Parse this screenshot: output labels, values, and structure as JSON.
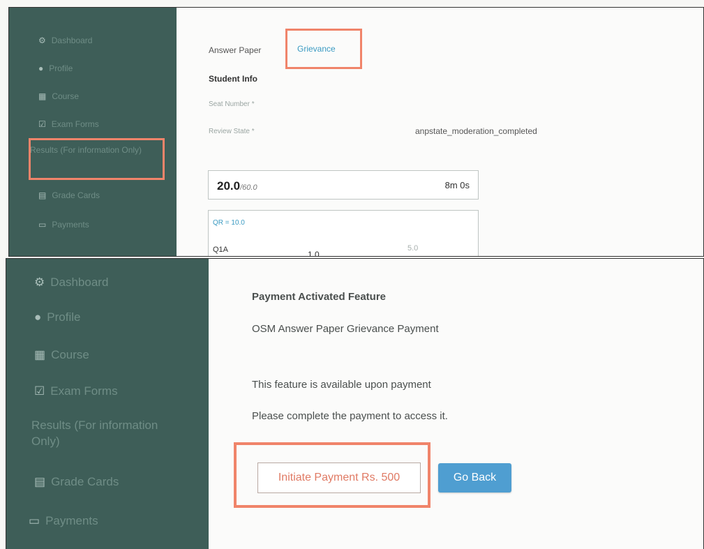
{
  "sidebar": {
    "items": [
      {
        "icon": "dashboard-icon",
        "label": "Dashboard"
      },
      {
        "icon": "profile-icon",
        "label": "Profile"
      },
      {
        "icon": "course-icon",
        "label": "Course"
      },
      {
        "icon": "exam-forms-icon",
        "label": "Exam Forms"
      },
      {
        "icon": "",
        "label": "Results (For information Only)"
      },
      {
        "icon": "grade-cards-icon",
        "label": "Grade Cards"
      },
      {
        "icon": "payments-icon",
        "label": "Payments"
      }
    ]
  },
  "answer_paper": {
    "tabs": [
      "Answer Paper",
      "Grievance"
    ],
    "student_info_title": "Student Info",
    "seat_number_label": "Seat Number *",
    "review_state_label": "Review State *",
    "review_state_value": "anpstate_moderation_completed",
    "score": "20.0",
    "score_max": "/60.0",
    "timer": "8m 0s",
    "question_summary": "QR = 10.0",
    "question_rows": [
      {
        "label": "Q1A",
        "marks": "1.0",
        "max": "5.0"
      }
    ]
  },
  "payment": {
    "title": "Payment Activated Feature",
    "subtitle": "OSM Answer Paper Grievance Payment",
    "notice": "This feature is available upon payment",
    "instruction": "Please complete the payment to access it.",
    "initiate_button": "Initiate Payment Rs. 500",
    "back_button": "Go Back"
  },
  "colors": {
    "sidebar_bg": "#3e5e58",
    "highlight": "#f0846a",
    "link_blue": "#3a9ac2",
    "button_blue": "#4f9ed1"
  }
}
